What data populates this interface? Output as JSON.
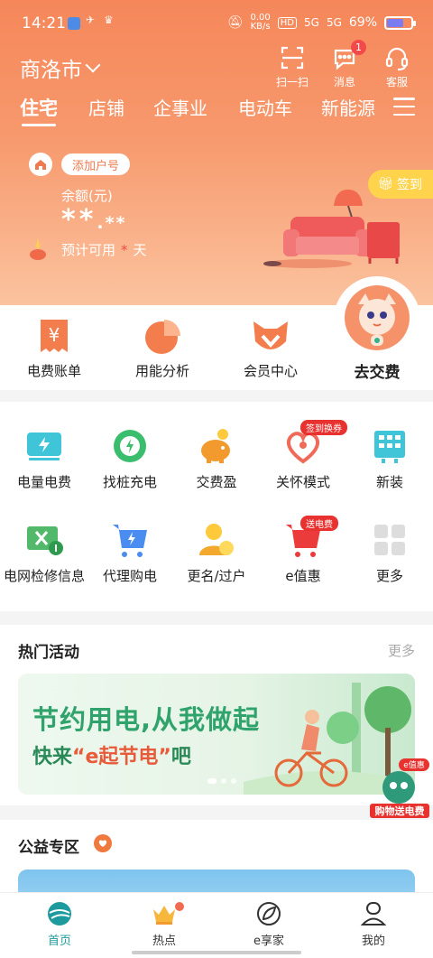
{
  "status_bar": {
    "time": "14:21",
    "net_speed": "0.00",
    "net_unit": "KB/s",
    "hd": "HD",
    "signal1": "5G",
    "signal2": "5G",
    "battery": "69%",
    "battery_level": 0.69
  },
  "header": {
    "city": "商洛市",
    "actions": [
      {
        "label": "扫一扫"
      },
      {
        "label": "消息",
        "badge": "1"
      },
      {
        "label": "客服"
      }
    ],
    "tabs": [
      "住宅",
      "店铺",
      "企事业",
      "电动车",
      "新能源"
    ],
    "active_tab": "住宅"
  },
  "account": {
    "add_label": "添加户号",
    "balance_label": "余额(元)",
    "balance_main": "**",
    "balance_dot": ".",
    "balance_small": "**",
    "avail_prefix": "预计可用",
    "avail_value": "*",
    "avail_suffix": "天",
    "signin": "签到"
  },
  "quick": {
    "items": [
      "电费账单",
      "用能分析",
      "会员中心"
    ],
    "pay": "去交费"
  },
  "services": [
    {
      "label": "电量电费"
    },
    {
      "label": "找桩充电"
    },
    {
      "label": "交费盈"
    },
    {
      "label": "关怀模式",
      "tag": "签到换券"
    },
    {
      "label": "新装"
    },
    {
      "label": "电网检修信息"
    },
    {
      "label": "代理购电"
    },
    {
      "label": "更名/过户"
    },
    {
      "label": "e值惠",
      "tag": "送电费"
    },
    {
      "label": "更多"
    }
  ],
  "hot": {
    "title": "热门活动",
    "more": "更多",
    "banner_line1": "节约用电,从我做起",
    "banner_line2_a": "快来",
    "banner_line2_q1": "“",
    "banner_line2_b": "e起节电",
    "banner_line2_q2": "”",
    "banner_line2_c": "吧",
    "promo_top": "e值惠",
    "promo_bottom": "购物送电费"
  },
  "charity": {
    "title": "公益专区"
  },
  "bottom_nav": [
    {
      "label": "首页"
    },
    {
      "label": "热点"
    },
    {
      "label": "e享家"
    },
    {
      "label": "我的"
    }
  ],
  "colors": {
    "brand": "#f5875a",
    "accent_teal": "#1d9a9e",
    "red": "#e8322f"
  }
}
